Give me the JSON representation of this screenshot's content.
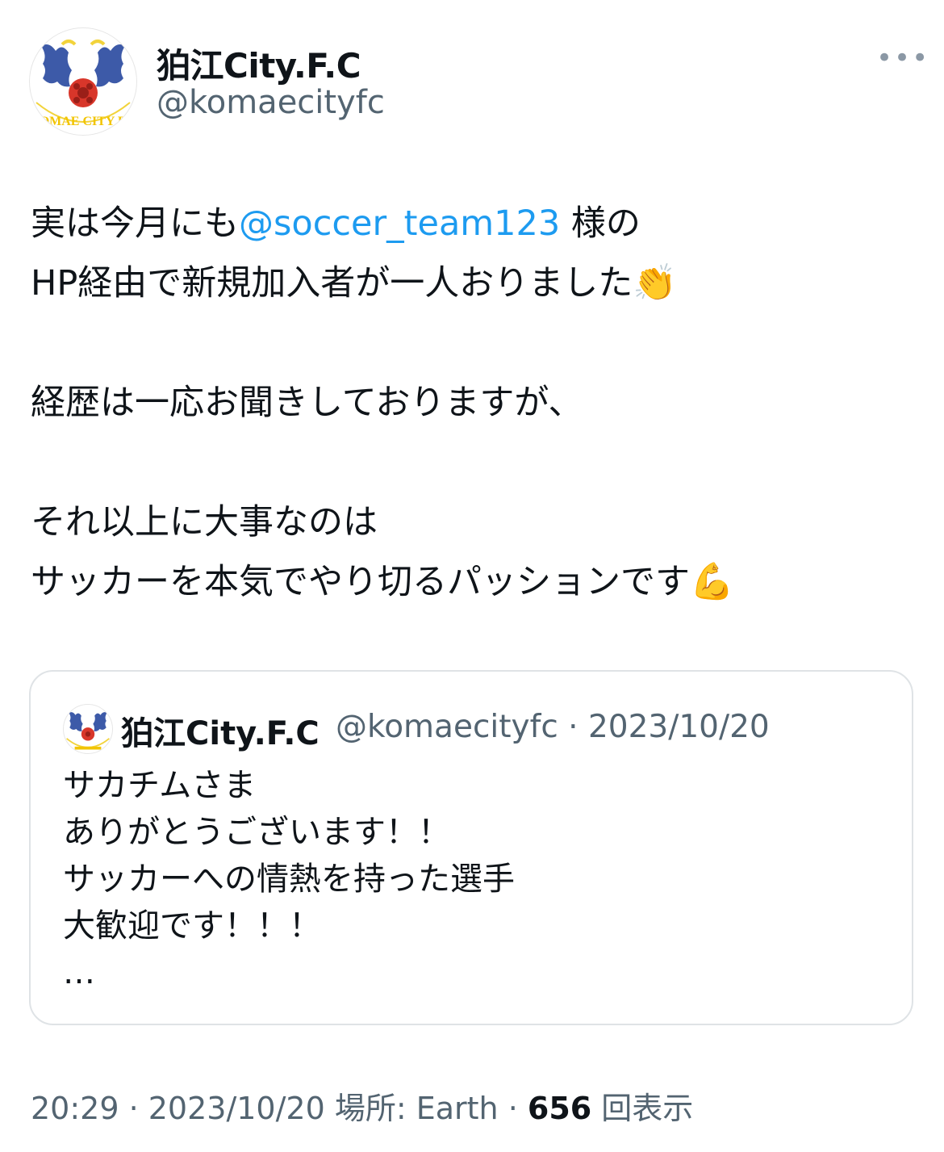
{
  "header": {
    "display_name": "狛江City.F.C",
    "handle": "@komaecityfc",
    "avatar_icon": "club-crest-icon",
    "avatar_text": "KOMAE CITY F.C",
    "more_label": "•••"
  },
  "tweet": {
    "line1_prefix": "実は今月にも",
    "line1_mention": "@soccer_team123",
    "line1_suffix": " 様の",
    "line2": "HP経由で新規加入者が一人おりました",
    "line2_emoji": "👏",
    "line3": "経歴は一応お聞きしておりますが、",
    "line4": "それ以上に大事なのは",
    "line5": "サッカーを本気でやり切るパッションです",
    "line5_emoji": "💪"
  },
  "quote": {
    "display_name": "狛江City.F.C",
    "handle_date": "@komaecityfc · 2023/10/20",
    "lines": [
      "サカチムさま",
      "ありがとうございます！！",
      "サッカーへの情熱を持った選手",
      "大歓迎です！！！",
      "…"
    ]
  },
  "meta": {
    "time_date_place": "20:29 · 2023/10/20 場所: Earth · ",
    "view_count": "656",
    "views_label": " 回表示"
  },
  "colors": {
    "mention": "#1d9bf0",
    "secondary_text": "#536471",
    "crest_blue": "#3d5aa8",
    "crest_yellow": "#f2d33b",
    "ball_red": "#d8362a"
  }
}
